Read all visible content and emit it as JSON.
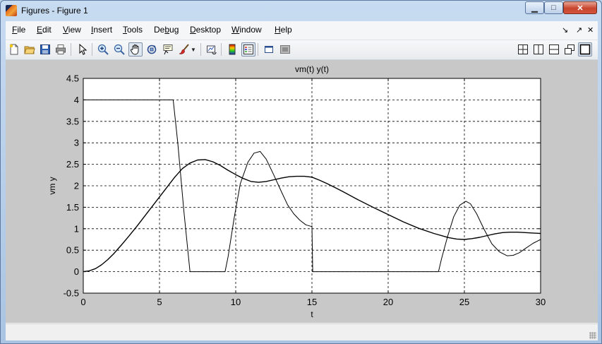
{
  "window": {
    "title": "Figures - Figure 1",
    "controls": {
      "minimize": "▁",
      "maximize": "□",
      "close": "✕"
    }
  },
  "menu": {
    "items": [
      {
        "label": "File",
        "accel": "F"
      },
      {
        "label": "Edit",
        "accel": "E"
      },
      {
        "label": "View",
        "accel": "V"
      },
      {
        "label": "Insert",
        "accel": "I"
      },
      {
        "label": "Tools",
        "accel": "T"
      },
      {
        "label": "Debug",
        "accel": "b"
      },
      {
        "label": "Desktop",
        "accel": "D"
      },
      {
        "label": "Window",
        "accel": "W"
      },
      {
        "label": "Help",
        "accel": "H"
      }
    ],
    "right_glyphs": [
      "↘",
      "↗",
      "✕"
    ]
  },
  "toolbar": {
    "left_icons": [
      "new-figure-icon",
      "open-file-icon",
      "save-icon",
      "print-icon",
      "select-arrow-icon",
      "zoom-in-icon",
      "zoom-out-icon",
      "pan-hand-icon",
      "rotate-3d-icon",
      "data-cursor-icon",
      "brush-icon",
      "brush-dropdown-icon",
      "link-plot-icon",
      "colorbar-icon",
      "legend-icon",
      "hide-plot-tools-icon",
      "show-plot-tools-icon"
    ],
    "right_icons": [
      "tile-grid-icon",
      "tile-columns-icon",
      "tile-rows-icon",
      "float-icon",
      "maximize-figure-icon"
    ]
  },
  "chart_data": {
    "type": "line",
    "title": "vm(t) y(t)",
    "xlabel": "t",
    "ylabel": "vm y",
    "xlim": [
      0,
      30
    ],
    "ylim": [
      -0.5,
      4.5
    ],
    "xticks": [
      "0",
      "5",
      "10",
      "15",
      "20",
      "25",
      "30"
    ],
    "yticks": [
      "-0.5",
      "0",
      "0.5",
      "1",
      "1.5",
      "2",
      "2.5",
      "3",
      "3.5",
      "4",
      "4.5"
    ],
    "grid": "on (dashed)",
    "series": [
      {
        "stroke": "#000000",
        "width": 1.0,
        "x": [
          0,
          5,
          5.7,
          5.9,
          6.2,
          6.6,
          7.0,
          7.1,
          8.2,
          9.3,
          9.5,
          9.9,
          10.3,
          10.8,
          11.2,
          11.6,
          12.0,
          12.5,
          13.0,
          13.4,
          13.8,
          14.2,
          14.6,
          15.0,
          15.0,
          15.05,
          20,
          23.3,
          23.5,
          23.9,
          24.3,
          24.7,
          25.1,
          25.4,
          25.8,
          26.3,
          26.8,
          27.3,
          27.8,
          28.2,
          28.6,
          29.0,
          29.5,
          30.0
        ],
        "y": [
          4,
          4,
          4,
          4,
          3.0,
          1.4,
          0.0,
          0.0,
          0.0,
          0.0,
          0.35,
          1.25,
          2.05,
          2.55,
          2.76,
          2.8,
          2.62,
          2.25,
          1.86,
          1.56,
          1.35,
          1.2,
          1.09,
          1.05,
          1.07,
          0.0,
          0.0,
          0.0,
          0.3,
          0.82,
          1.28,
          1.55,
          1.64,
          1.58,
          1.35,
          0.98,
          0.65,
          0.46,
          0.37,
          0.38,
          0.44,
          0.54,
          0.66,
          0.75
        ]
      },
      {
        "stroke": "#000000",
        "width": 1.4,
        "x": [
          0,
          0.4,
          0.8,
          1.2,
          1.6,
          2,
          2.5,
          3,
          3.5,
          4,
          4.5,
          5,
          5.5,
          6,
          6.5,
          7,
          7.5,
          8,
          8.5,
          9,
          9.5,
          10,
          10.5,
          11,
          11.5,
          12,
          12.5,
          13,
          13.5,
          14,
          14.5,
          15,
          15.5,
          16,
          16.5,
          17,
          18,
          19,
          20,
          21,
          22,
          23,
          24,
          24.5,
          25,
          25.5,
          26,
          26.5,
          27,
          27.5,
          28,
          28.5,
          29,
          29.5,
          30
        ],
        "y": [
          0,
          0.02,
          0.07,
          0.16,
          0.28,
          0.42,
          0.62,
          0.83,
          1.05,
          1.28,
          1.51,
          1.74,
          1.97,
          2.2,
          2.4,
          2.53,
          2.6,
          2.61,
          2.56,
          2.47,
          2.36,
          2.26,
          2.17,
          2.1,
          2.08,
          2.1,
          2.14,
          2.18,
          2.21,
          2.22,
          2.22,
          2.2,
          2.13,
          2.05,
          1.96,
          1.87,
          1.68,
          1.5,
          1.33,
          1.16,
          1.01,
          0.89,
          0.79,
          0.76,
          0.75,
          0.77,
          0.8,
          0.84,
          0.88,
          0.91,
          0.92,
          0.92,
          0.91,
          0.9,
          0.89
        ]
      }
    ]
  }
}
